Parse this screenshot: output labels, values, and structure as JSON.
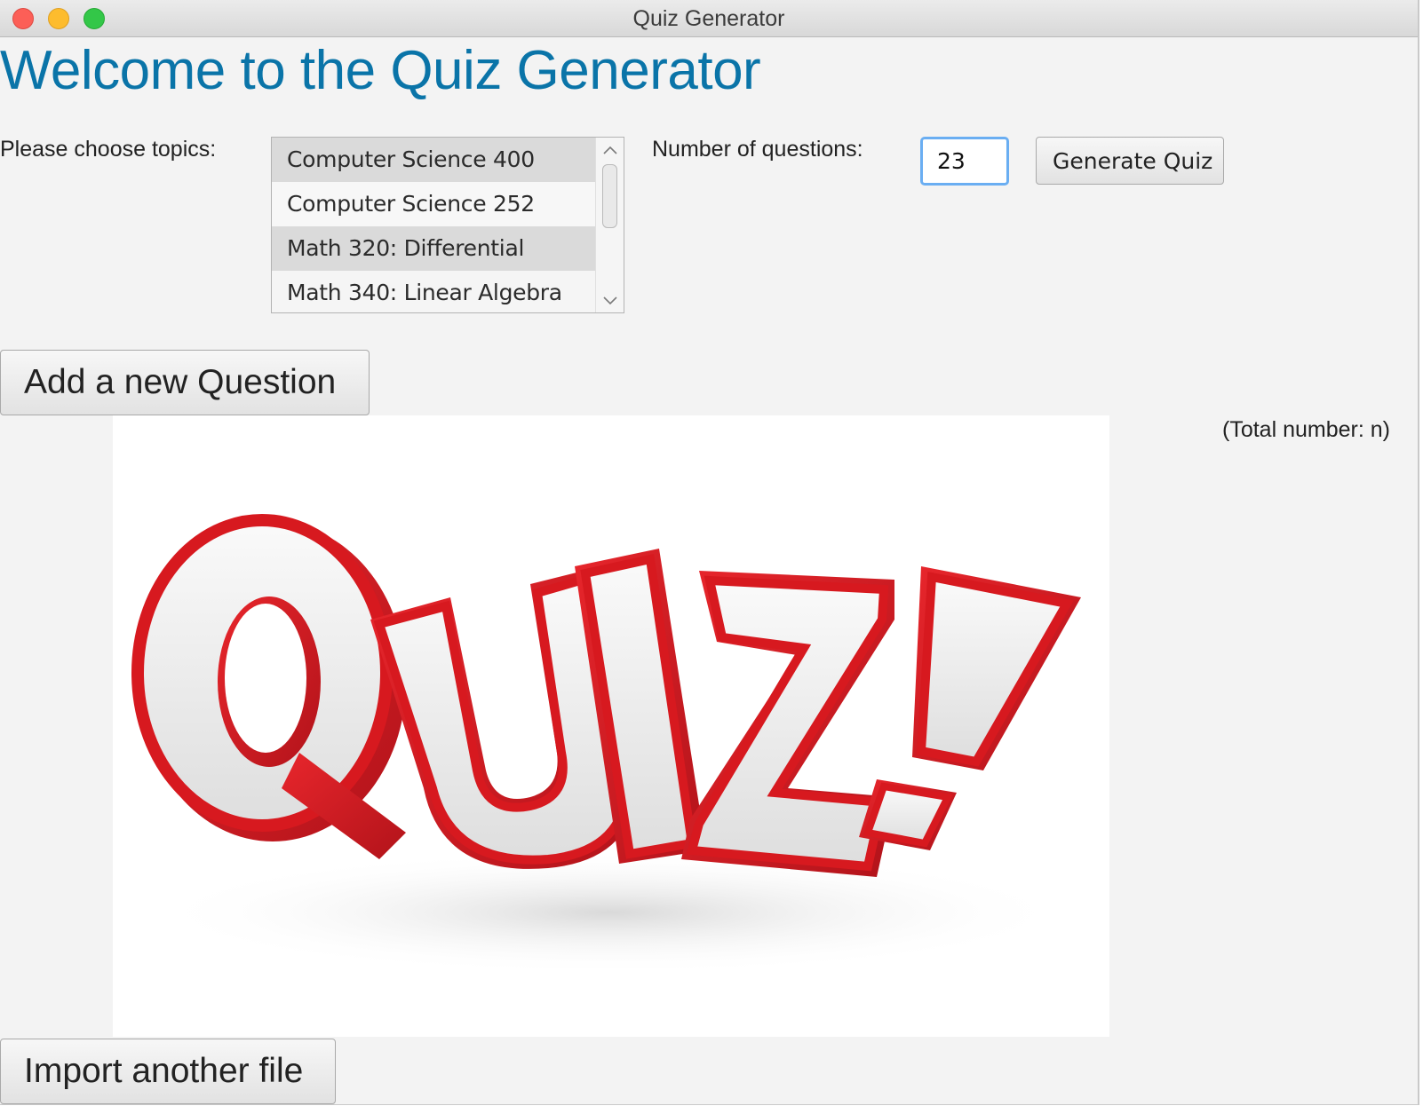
{
  "window": {
    "title": "Quiz Generator"
  },
  "main": {
    "heading": "Welcome to the Quiz Generator",
    "topics_label": "Please choose topics:",
    "topics": [
      {
        "label": "Computer Science 400",
        "selected": true
      },
      {
        "label": "Computer Science 252",
        "selected": false
      },
      {
        "label": "Math 320: Differential",
        "selected": true
      },
      {
        "label": "Math 340: Linear Algebra",
        "selected": false
      }
    ],
    "num_questions_label": "Number of questions:",
    "num_questions_value": "23",
    "generate_label": "Generate Quiz",
    "add_question_label": "Add a new Question",
    "total_label": "(Total number: n)",
    "import_label": "Import another file"
  },
  "image": {
    "text": "QUIZ!",
    "colors": {
      "red": "#d7191f",
      "face": "#f2f2f2",
      "shadow": "#e6e6e6"
    }
  },
  "colors": {
    "heading": "#0a74a8",
    "focus_ring": "#6aaef2",
    "selected_row": "#dadada"
  }
}
